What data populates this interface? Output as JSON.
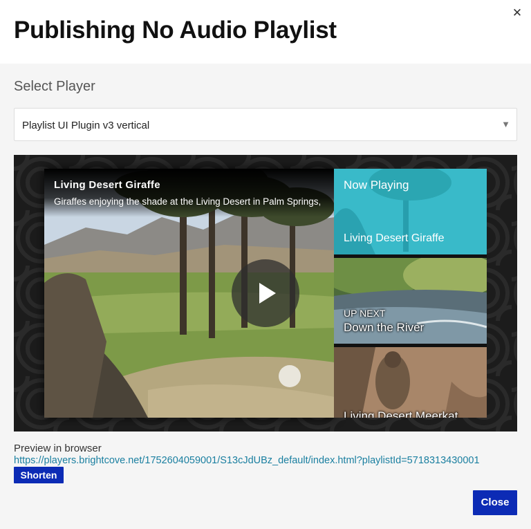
{
  "modal": {
    "title": "Publishing No Audio Playlist",
    "close_icon": "close-icon",
    "close_glyph": "✕"
  },
  "player_select": {
    "label": "Select Player",
    "value": "Playlist UI Plugin v3 vertical",
    "arrow_glyph": "▼"
  },
  "preview": {
    "video": {
      "title": "Living Desert Giraffe",
      "description": "Giraffes enjoying the shade at the Living Desert in Palm Springs,",
      "play_icon": "play-icon"
    },
    "playlist": {
      "now_playing_label": "Now Playing",
      "now_playing_title": "Living Desert Giraffe",
      "up_next_label": "UP NEXT",
      "up_next_title": "Down the River",
      "third_title": "Living Desert Meerkat"
    }
  },
  "browser_preview": {
    "label": "Preview in browser",
    "url": "https://players.brightcove.net/1752604059001/S13cJdUBz_default/index.html?playlistId=5718313430001",
    "shorten_label": "Shorten"
  },
  "footer": {
    "close_label": "Close"
  },
  "colors": {
    "primary_button": "#0c2bb5",
    "link": "#1a7fa0",
    "now_playing": "#22b5c8"
  }
}
